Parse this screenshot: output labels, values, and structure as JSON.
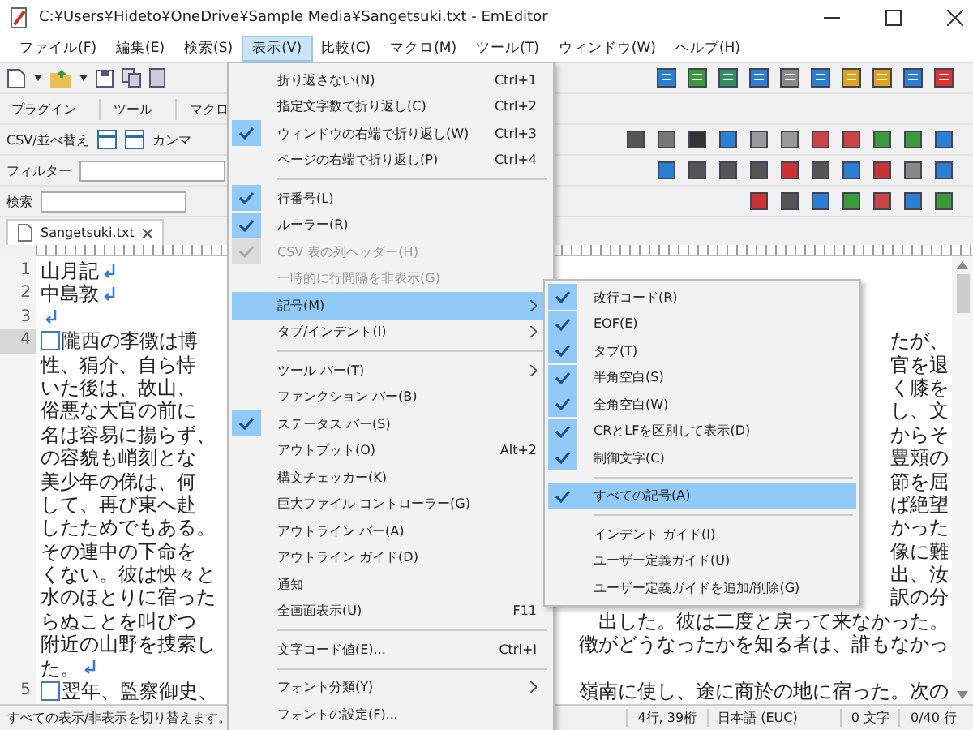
{
  "window": {
    "title": "C:¥Users¥Hideto¥OneDrive¥Sample Media¥Sangetsuki.txt - EmEditor"
  },
  "menu_bar": [
    {
      "label": "ファイル(F)",
      "selected": false
    },
    {
      "label": "編集(E)",
      "selected": false
    },
    {
      "label": "検索(S)",
      "selected": false
    },
    {
      "label": "表示(V)",
      "selected": true
    },
    {
      "label": "比較(C)",
      "selected": false
    },
    {
      "label": "マクロ(M)",
      "selected": false
    },
    {
      "label": "ツール(T)",
      "selected": false
    },
    {
      "label": "ウィンドウ(W)",
      "selected": false
    },
    {
      "label": "ヘルプ(H)",
      "selected": false
    }
  ],
  "plugin_bar": [
    "プラグイン",
    "ツール",
    "マクロ"
  ],
  "csv_bar": {
    "label": "CSV/並べ替え",
    "items": [
      "カンマ"
    ]
  },
  "filter_bar": {
    "label": "フィルター"
  },
  "search_bar": {
    "label": "検索"
  },
  "tab": {
    "label": "Sangetsuki.txt"
  },
  "document": {
    "lines": [
      {
        "number": "1",
        "current": false,
        "fullwidth_space": false,
        "eol": true,
        "rows": [
          {
            "left": "山月記"
          }
        ]
      },
      {
        "number": "2",
        "current": false,
        "fullwidth_space": false,
        "eol": true,
        "rows": [
          {
            "left": "中島敦"
          }
        ]
      },
      {
        "number": "3",
        "current": false,
        "fullwidth_space": false,
        "eol": true
      },
      {
        "number": "4",
        "current": true,
        "fullwidth_space": true,
        "eol": true,
        "rows": [
          {
            "left": "隴西の李徴は博",
            "right": "たが、"
          },
          {
            "left": "性、狷介、自ら恃",
            "right": "官を退"
          },
          {
            "left": "いた後は、故山、",
            "right": "く膝を"
          },
          {
            "left": "俗悪な大官の前に",
            "right": "し、文"
          },
          {
            "left": "名は容易に揚らず、",
            "right": "からそ"
          },
          {
            "left": "の容貌も峭刻とな",
            "right": "豊頬の"
          },
          {
            "left": "美少年の俤は、何",
            "right": "節を屈"
          },
          {
            "left": "して、再び東へ赴",
            "right": "ば絶望"
          },
          {
            "left": "したためでもある。",
            "right": "かった"
          },
          {
            "left": "その連中の下命を",
            "right": "像に難"
          },
          {
            "left": "くない。彼は怏々と",
            "right": "出、汝"
          },
          {
            "left": "水のほとりに宿った",
            "right": "訳の分"
          },
          {
            "left": "らぬことを叫びつ",
            "right": "出した。彼は二度と戻って来なかった。"
          },
          {
            "left": "附近の山野を捜索し",
            "right": "徴がどうなったかを知る者は、誰もなかっ"
          },
          {
            "left": "た。"
          }
        ]
      },
      {
        "number": "5",
        "current": false,
        "fullwidth_space": true,
        "eol": false,
        "rows": [
          {
            "left": "翌年、監察御史、",
            "right": "嶺南に使し、途に商於の地に宿った。次の"
          }
        ]
      }
    ]
  },
  "view_menu": {
    "items": [
      {
        "kind": "item",
        "label": "折り返さない(N)",
        "shortcut": "Ctrl+1",
        "checked": false,
        "disabled": false,
        "submenu": false,
        "selected": false
      },
      {
        "kind": "item",
        "label": "指定文字数で折り返し(C)",
        "shortcut": "Ctrl+2",
        "checked": false,
        "disabled": false,
        "submenu": false,
        "selected": false
      },
      {
        "kind": "item",
        "label": "ウィンドウの右端で折り返し(W)",
        "shortcut": "Ctrl+3",
        "checked": true,
        "disabled": false,
        "submenu": false,
        "selected": false
      },
      {
        "kind": "item",
        "label": "ページの右端で折り返し(P)",
        "shortcut": "Ctrl+4",
        "checked": false,
        "disabled": false,
        "submenu": false,
        "selected": false
      },
      {
        "kind": "separator"
      },
      {
        "kind": "item",
        "label": "行番号(L)",
        "checked": true,
        "disabled": false,
        "submenu": false,
        "selected": false
      },
      {
        "kind": "item",
        "label": "ルーラー(R)",
        "checked": true,
        "disabled": false,
        "submenu": false,
        "selected": false
      },
      {
        "kind": "item",
        "label": "CSV 表の列ヘッダー(H)",
        "checked": true,
        "disabled": true,
        "submenu": false,
        "selected": false
      },
      {
        "kind": "item",
        "label": "一時的に行間隔を非表示(G)",
        "checked": false,
        "disabled": true,
        "submenu": false,
        "selected": false
      },
      {
        "kind": "item",
        "label": "記号(M)",
        "checked": false,
        "disabled": false,
        "submenu": true,
        "selected": true
      },
      {
        "kind": "item",
        "label": "タブ/インデント(I)",
        "checked": false,
        "disabled": false,
        "submenu": true,
        "selected": false
      },
      {
        "kind": "separator"
      },
      {
        "kind": "item",
        "label": "ツール バー(T)",
        "checked": false,
        "disabled": false,
        "submenu": true,
        "selected": false
      },
      {
        "kind": "item",
        "label": "ファンクション バー(B)",
        "checked": false,
        "disabled": false,
        "submenu": false,
        "selected": false
      },
      {
        "kind": "item",
        "label": "ステータス バー(S)",
        "checked": true,
        "disabled": false,
        "submenu": false,
        "selected": false
      },
      {
        "kind": "item",
        "label": "アウトプット(O)",
        "shortcut": "Alt+2",
        "checked": false,
        "disabled": false,
        "submenu": false,
        "selected": false
      },
      {
        "kind": "item",
        "label": "構文チェッカー(K)",
        "checked": false,
        "disabled": false,
        "submenu": false,
        "selected": false
      },
      {
        "kind": "item",
        "label": "巨大ファイル コントローラー(G)",
        "checked": false,
        "disabled": false,
        "submenu": false,
        "selected": false
      },
      {
        "kind": "item",
        "label": "アウトライン バー(A)",
        "checked": false,
        "disabled": false,
        "submenu": false,
        "selected": false
      },
      {
        "kind": "item",
        "label": "アウトライン ガイド(D)",
        "checked": false,
        "disabled": false,
        "submenu": false,
        "selected": false
      },
      {
        "kind": "item",
        "label": "通知",
        "checked": false,
        "disabled": false,
        "submenu": false,
        "selected": false
      },
      {
        "kind": "item",
        "label": "全画面表示(U)",
        "shortcut": "F11",
        "checked": false,
        "disabled": false,
        "submenu": false,
        "selected": false
      },
      {
        "kind": "separator"
      },
      {
        "kind": "item",
        "label": "文字コード値(E)...",
        "shortcut": "Ctrl+I",
        "checked": false,
        "disabled": false,
        "submenu": false,
        "selected": false
      },
      {
        "kind": "separator"
      },
      {
        "kind": "item",
        "label": "フォント分類(Y)",
        "checked": false,
        "disabled": false,
        "submenu": true,
        "selected": false
      },
      {
        "kind": "item",
        "label": "フォントの設定(F)...",
        "checked": false,
        "disabled": false,
        "submenu": false,
        "selected": false
      }
    ]
  },
  "symbols_submenu": {
    "items": [
      {
        "kind": "item",
        "label": "改行コード(R)",
        "checked": true,
        "selected": false
      },
      {
        "kind": "item",
        "label": "EOF(E)",
        "checked": true,
        "selected": false
      },
      {
        "kind": "item",
        "label": "タブ(T)",
        "checked": true,
        "selected": false
      },
      {
        "kind": "item",
        "label": "半角空白(S)",
        "checked": true,
        "selected": false
      },
      {
        "kind": "item",
        "label": "全角空白(W)",
        "checked": true,
        "selected": false
      },
      {
        "kind": "item",
        "label": "CRとLFを区別して表示(D)",
        "checked": true,
        "selected": false
      },
      {
        "kind": "item",
        "label": "制御文字(C)",
        "checked": true,
        "selected": false
      },
      {
        "kind": "separator"
      },
      {
        "kind": "item",
        "label": "すべての記号(A)",
        "checked": true,
        "selected": true
      },
      {
        "kind": "separator"
      },
      {
        "kind": "item",
        "label": "インデント ガイド(I)",
        "checked": false,
        "selected": false
      },
      {
        "kind": "item",
        "label": "ユーザー定義ガイド(U)",
        "checked": false,
        "selected": false
      },
      {
        "kind": "item",
        "label": "ユーザー定義ガイドを追加/削除(G)",
        "checked": false,
        "selected": false
      }
    ]
  },
  "status_bar": {
    "message": "すべての表示/非表示を切り替えます。",
    "position": "4行, 39桁",
    "encoding": "日本語 (EUC)",
    "selection": "0 文字",
    "lines": "0/40 行"
  }
}
